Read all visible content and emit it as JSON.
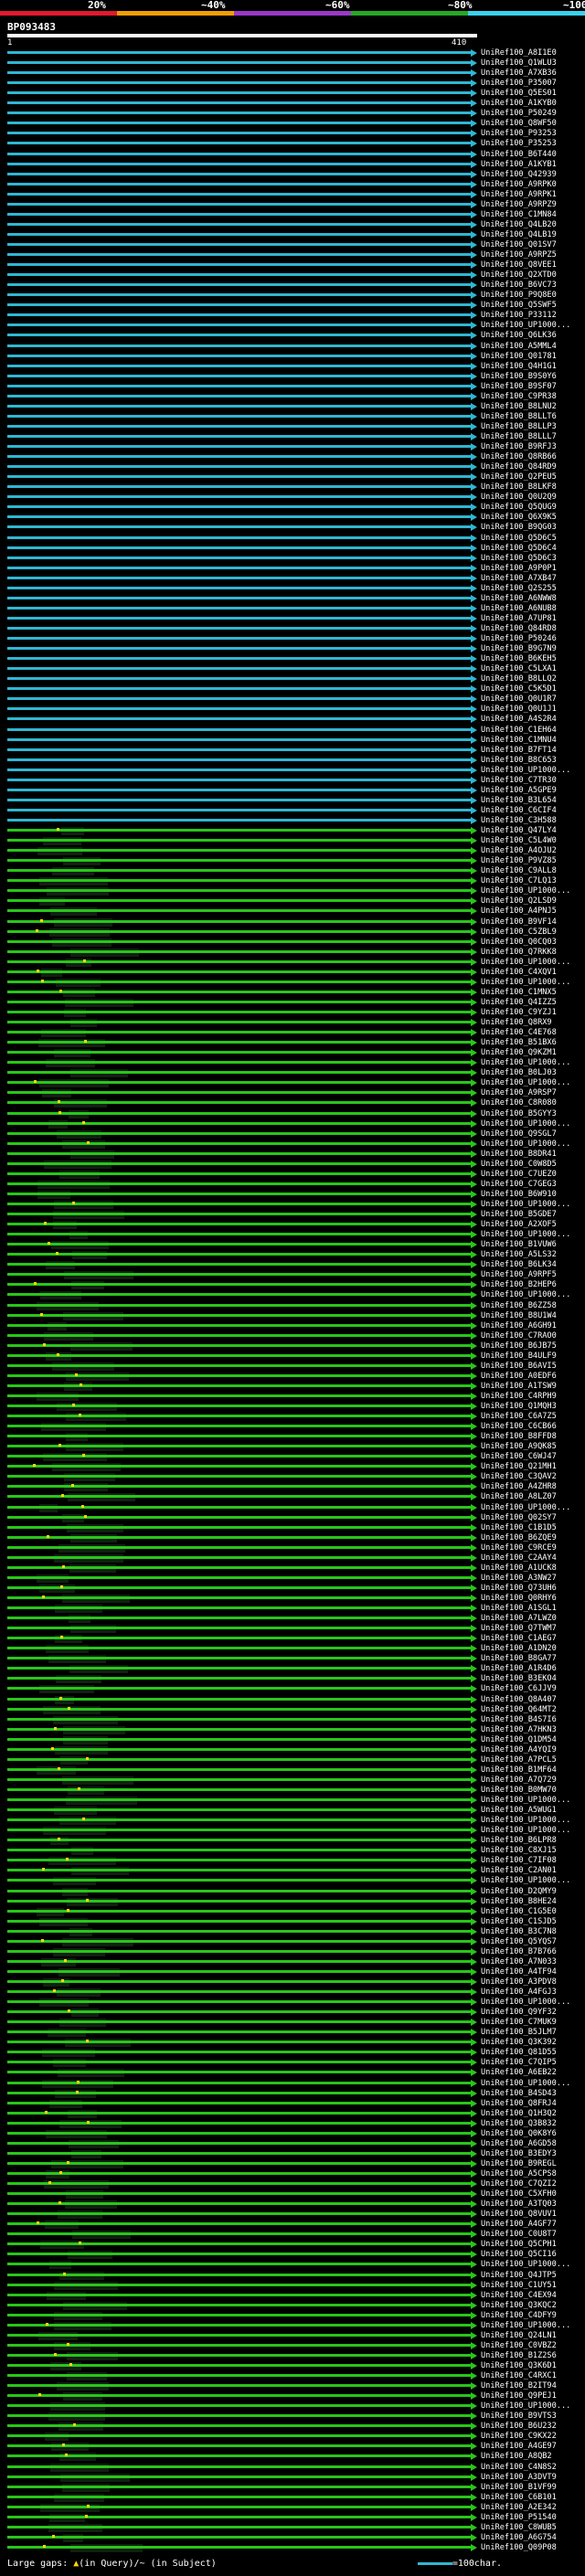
{
  "scale": {
    "labels": [
      "20%",
      "~40%",
      "~60%",
      "~80%",
      "~100%"
    ],
    "colors": [
      "#e3192d",
      "#f29f05",
      "#9b38c9",
      "#26a727",
      "#3ad1ee"
    ]
  },
  "query": {
    "name": "BP093483",
    "start": "1",
    "end": "410"
  },
  "hits": [
    "UniRef100_A8I1E0",
    "UniRef100_Q1WLU3",
    "UniRef100_A7XB36",
    "UniRef100_P35007",
    "UniRef100_Q5ES01",
    "UniRef100_A1KYB0",
    "UniRef100_P50249",
    "UniRef100_Q8WF50",
    "UniRef100_P93253",
    "UniRef100_P35253",
    "UniRef100_B6T440",
    "UniRef100_A1KYB1",
    "UniRef100_Q42939",
    "UniRef100_A9RPK0",
    "UniRef100_A9RPK1",
    "UniRef100_A9RPZ9",
    "UniRef100_C1MN84",
    "UniRef100_Q4LB20",
    "UniRef100_Q4LB19",
    "UniRef100_Q01SV7",
    "UniRef100_A9RPZ5",
    "UniRef100_Q8VEE1",
    "UniRef100_Q2XTD0",
    "UniRef100_B6VC73",
    "UniRef100_P9Q8E0",
    "UniRef100_Q5SWF5",
    "UniRef100_P33112",
    "UniRef100_UP1000...",
    "UniRef100_Q6LK36",
    "UniRef100_A5MML4",
    "UniRef100_Q01781",
    "UniRef100_Q4H1G1",
    "UniRef100_B9S0Y6",
    "UniRef100_B9SF07",
    "UniRef100_C9PR38",
    "UniRef100_B8LNU2",
    "UniRef100_B8LLT6",
    "UniRef100_B8LLP3",
    "UniRef100_B8LLL7",
    "UniRef100_B9RFJ3",
    "UniRef100_Q8RB66",
    "UniRef100_Q84RD9",
    "UniRef100_Q2PEU5",
    "UniRef100_B8LKF8",
    "UniRef100_Q0U2Q9",
    "UniRef100_Q5QUG9",
    "UniRef100_Q6X9K5",
    "UniRef100_B9QG03",
    "UniRef100_Q5D6C5",
    "UniRef100_Q5D6C4",
    "UniRef100_Q5D6C3",
    "UniRef100_A9P0P1",
    "UniRef100_A7XB47",
    "UniRef100_Q2S255",
    "UniRef100_A6NWW8",
    "UniRef100_A6NUB8",
    "UniRef100_A7UP81",
    "UniRef100_Q84RD8",
    "UniRef100_P50246",
    "UniRef100_B9G7N9",
    "UniRef100_B6KEH5",
    "UniRef100_C5LXA1",
    "UniRef100_B8LLQ2",
    "UniRef100_C5K5D1",
    "UniRef100_Q0U1R7",
    "UniRef100_Q0U1J1",
    "UniRef100_A4S2R4",
    "UniRef100_C1EH64",
    "UniRef100_C1MNU4",
    "UniRef100_B7FT14",
    "UniRef100_B8C653",
    "UniRef100_UP1000...",
    "UniRef100_C7TR30",
    "UniRef100_A5GPE9",
    "UniRef100_B3L654",
    "UniRef100_C6CIF4",
    "UniRef100_C3H588",
    "UniRef100_Q47LY4",
    "UniRef100_C5L4W0",
    "UniRef100_A4OJU2",
    "UniRef100_P9VZ85",
    "UniRef100_C9ALL8",
    "UniRef100_C7LQ13",
    "UniRef100_UP1000...",
    "UniRef100_Q2LSD9",
    "UniRef100_A4PNJ5",
    "UniRef100_B9VF14",
    "UniRef100_C5ZBL9",
    "UniRef100_Q0CQ03",
    "UniRef100_Q7RKK8",
    "UniRef100_UP1000...",
    "UniRef100_C4XQV1",
    "UniRef100_UP1000...",
    "UniRef100_C1MNX5",
    "UniRef100_Q4IZZ5",
    "UniRef100_C9YZJ1",
    "UniRef100_Q8RX9",
    "UniRef100_C4E768",
    "UniRef100_B51BX6",
    "UniRef100_Q9KZM1",
    "UniRef100_UP1000...",
    "UniRef100_B0LJ03",
    "UniRef100_UP1000...",
    "UniRef100_A9RSP7",
    "UniRef100_C8R080",
    "UniRef100_B5GYY3",
    "UniRef100_UP1000...",
    "UniRef100_Q9SGL7",
    "UniRef100_UP1000...",
    "UniRef100_B8DR41",
    "UniRef100_C0W8D5",
    "UniRef100_C7UEZ0",
    "UniRef100_C7GEG3",
    "UniRef100_B6W910",
    "UniRef100_UP1000...",
    "UniRef100_B5GDE7",
    "UniRef100_A2XOF5",
    "UniRef100_UP1000...",
    "UniRef100_B1VUW6",
    "UniRef100_A5LS32",
    "UniRef100_B6LK34",
    "UniRef100_A9RPF5",
    "UniRef100_B2HEP6",
    "UniRef100_UP1000...",
    "UniRef100_B6ZZ58",
    "UniRef100_B8U1W4",
    "UniRef100_A6GH91",
    "UniRef100_C7RAO0",
    "UniRef100_B6JB75",
    "UniRef100_B4ULF9",
    "UniRef100_B6AVI5",
    "UniRef100_A0EDF6",
    "UniRef100_A1TSW9",
    "UniRef100_C4RPH9",
    "UniRef100_Q1MQH3",
    "UniRef100_C6A7Z5",
    "UniRef100_C6CB66",
    "UniRef100_B8FFD8",
    "UniRef100_A9QK85",
    "UniRef100_C6WJ47",
    "UniRef100_Q21MH1",
    "UniRef100_C3QAV2",
    "UniRef100_A4ZHR8",
    "UniRef100_A8LZ07",
    "UniRef100_UP1000...",
    "UniRef100_Q02SY7",
    "UniRef100_C1B1D5",
    "UniRef100_B6ZQE9",
    "UniRef100_C9RCE9",
    "UniRef100_C2AAY4",
    "UniRef100_A1UCK8",
    "UniRef100_A3NW27",
    "UniRef100_Q73UH6",
    "UniRef100_Q0RHY6",
    "UniRef100_A1SGL1",
    "UniRef100_A7LWZ0",
    "UniRef100_Q7TWM7",
    "UniRef100_C1AEG7",
    "UniRef100_A1DN20",
    "UniRef100_B8GA77",
    "UniRef100_A1R4D6",
    "UniRef100_B3EKO4",
    "UniRef100_C6JJV9",
    "UniRef100_Q8A407",
    "UniRef100_Q64MT2",
    "UniRef100_B4S7I6",
    "UniRef100_A7HKN3",
    "UniRef100_Q1DM54",
    "UniRef100_A4YQI9",
    "UniRef100_A7PCL5",
    "UniRef100_B1MF64",
    "UniRef100_A7Q729",
    "UniRef100_B0MW70",
    "UniRef100_UP1000...",
    "UniRef100_A5WUG1",
    "UniRef100_UP1000...",
    "UniRef100_UP1000...",
    "UniRef100_B6LPR8",
    "UniRef100_C8XJ15",
    "UniRef100_C7IF08",
    "UniRef100_C2AN01",
    "UniRef100_UP1000...",
    "UniRef100_D2QMY9",
    "UniRef100_B8HE24",
    "UniRef100_C1G5E0",
    "UniRef100_C1SJD5",
    "UniRef100_B3C7N8",
    "UniRef100_Q5YQS7",
    "UniRef100_B7B766",
    "UniRef100_A7N033",
    "UniRef100_A4TF94",
    "UniRef100_A3PDV8",
    "UniRef100_A4FGJ3",
    "UniRef100_UP1000...",
    "UniRef100_Q9YF32",
    "UniRef100_C7MUK9",
    "UniRef100_B5JLM7",
    "UniRef100_Q3K392",
    "UniRef100_Q81D55",
    "UniRef100_C7QIP5",
    "UniRef100_A6EB22",
    "UniRef100_UP1000...",
    "UniRef100_B4SD43",
    "UniRef100_Q8FRJ4",
    "UniRef100_Q1H3Q2",
    "UniRef100_Q3B832",
    "UniRef100_Q0K8Y6",
    "UniRef100_A6GD58",
    "UniRef100_B3EDY3",
    "UniRef100_B9REGL",
    "UniRef100_A5CPS8",
    "UniRef100_C7QZI2",
    "UniRef100_C5XFH0",
    "UniRef100_A3TQ03",
    "UniRef100_Q8VUV1",
    "UniRef100_A4GF77",
    "UniRef100_C0U8T7",
    "UniRef100_Q5CPH1",
    "UniRef100_Q5CI16",
    "UniRef100_UP1000...",
    "UniRef100_Q4JTP5",
    "UniRef100_C1UY51",
    "UniRef100_C4EX94",
    "UniRef100_Q3KQC2",
    "UniRef100_C4DFY9",
    "UniRef100_UP1000...",
    "UniRef100_Q24LN1",
    "UniRef100_C0VBZ2",
    "UniRef100_B1Z2S6",
    "UniRef100_Q3K6D1",
    "UniRef100_C4RXC1",
    "UniRef100_B2IT94",
    "UniRef100_Q9PEJ1",
    "UniRef100_UP1000...",
    "UniRef100_B9VTS3",
    "UniRef100_B6U232",
    "UniRef100_C9KX22",
    "UniRef100_A4GE97",
    "UniRef100_A8QB2",
    "UniRef100_C4N8S2",
    "UniRef100_A3DVT9",
    "UniRef100_B1VF99",
    "UniRef100_C6B101",
    "UniRef100_A2E342",
    "UniRef100_P51540",
    "UniRef100_C8WUB5",
    "UniRef100_A6G754",
    "UniRef100_Q09P08"
  ],
  "footer": {
    "gaps_label": "Large gaps: ",
    "gaps_query": "(in Query)",
    "gaps_subject": "/~ (in Subject)",
    "scale_label": "=100char."
  }
}
